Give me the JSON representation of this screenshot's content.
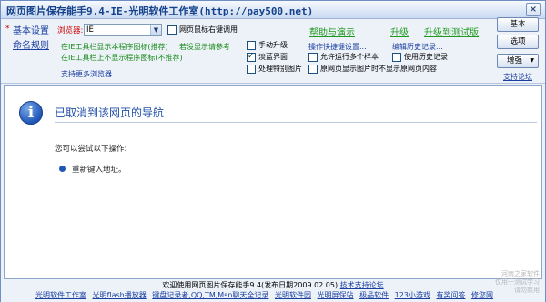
{
  "window": {
    "title": "网页图片保存能手9.4-IE-光明软件工作室(http://pay500.net)",
    "close_glyph": "×"
  },
  "toolbar": {
    "basic_settings": "基本设置",
    "naming_rules": "命名规则",
    "browser_label": "浏览器:",
    "browser_value": "IE",
    "right_click_label": "网页鼠标右键调用",
    "show_icon_recommended": "在IE工具栏显示本程序图标(推荐)",
    "no_show_reference": "若没显示请参考",
    "hide_icon_not_recommended": "在IE工具栏上不显示程序图标(不推荐)",
    "more_browsers": "支持更多浏览器",
    "help_demo": "帮助与演示",
    "upgrade": "升级",
    "upgrade_test": "升级到测试版",
    "checkboxes": [
      {
        "label": "手动升级",
        "checked": false
      },
      {
        "label": "淡蓝界面",
        "checked": true
      },
      {
        "label": "处理特别图片",
        "checked": false
      },
      {
        "label": "允许运行多个样本",
        "checked": false
      },
      {
        "label": "原网页显示图片时不显示原网页内容",
        "checked": false
      },
      {
        "label": "使用历史记录",
        "checked": false
      }
    ],
    "shortcut_settings": "操作快捷键设置...",
    "edit_history": "编辑历史记录...",
    "side_buttons": {
      "basic": "基本",
      "options": "选项",
      "enhance": "增强",
      "enhance_arrow": "▼"
    },
    "support_forum": "支持论坛"
  },
  "content": {
    "icon_glyph": "i",
    "nav_title": "已取消到该网页的导航",
    "suggestion": "您可以尝试以下操作:",
    "action": "重新键入地址。"
  },
  "footer": {
    "welcome": "欢迎使用网页图片保存能手9.4(发布日期2009.02.05)",
    "tech_forum": "技术支持论坛",
    "links": [
      "光明软件工作室",
      "光明flash播放器",
      "键盘记录者,QQ,TM,Msn聊天全记录",
      "光明软件园",
      "光明屏保站",
      "极品软件",
      "123小游戏",
      "有奖问答",
      "修您网"
    ]
  },
  "watermark": [
    "河南之家软件",
    "仅用于测试学习",
    "请勿商用"
  ]
}
